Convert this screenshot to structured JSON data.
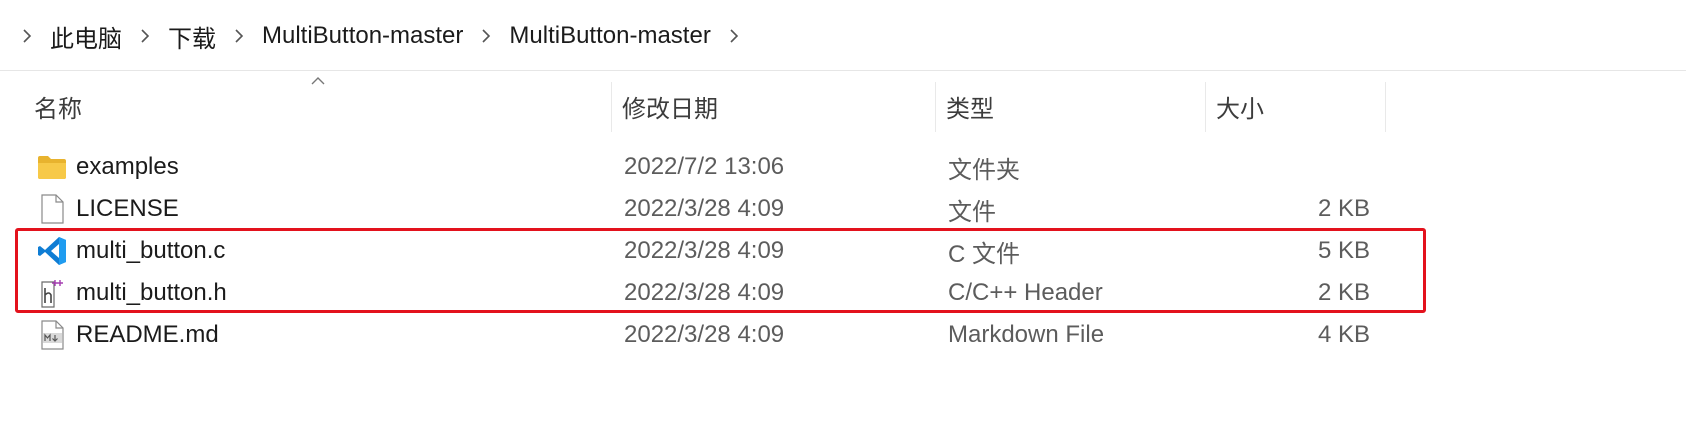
{
  "breadcrumb": [
    "此电脑",
    "下载",
    "MultiButton-master",
    "MultiButton-master"
  ],
  "columns": {
    "name": "名称",
    "date": "修改日期",
    "type": "类型",
    "size": "大小"
  },
  "files": [
    {
      "name": "examples",
      "date": "2022/7/2 13:06",
      "type": "文件夹",
      "size": "",
      "icon": "folder-icon"
    },
    {
      "name": "LICENSE",
      "date": "2022/3/28 4:09",
      "type": "文件",
      "size": "2 KB",
      "icon": "file-icon"
    },
    {
      "name": "multi_button.c",
      "date": "2022/3/28 4:09",
      "type": "C 文件",
      "size": "5 KB",
      "icon": "vscode-icon"
    },
    {
      "name": "multi_button.h",
      "date": "2022/3/28 4:09",
      "type": "C/C++ Header",
      "size": "2 KB",
      "icon": "header-file-icon"
    },
    {
      "name": "README.md",
      "date": "2022/3/28 4:09",
      "type": "Markdown File",
      "size": "4 KB",
      "icon": "markdown-file-icon"
    }
  ],
  "colors": {
    "highlight": "#e3121d",
    "folder": "#f7c948",
    "vscode": "#0f7dd4"
  }
}
